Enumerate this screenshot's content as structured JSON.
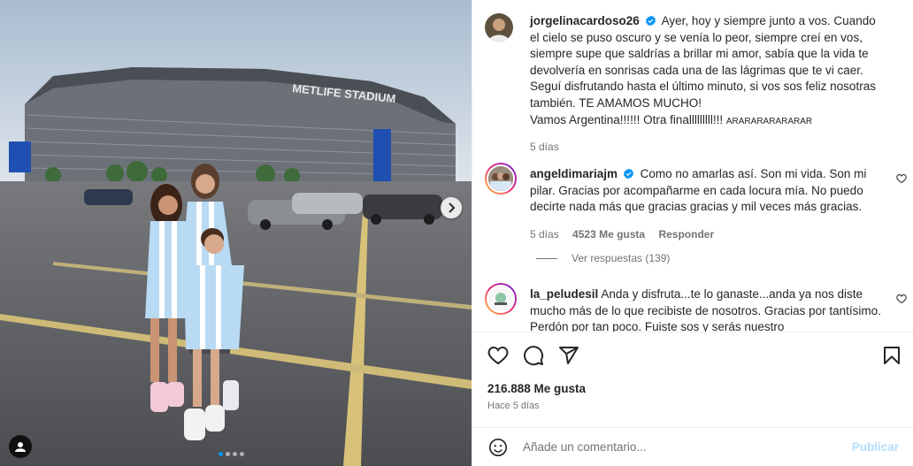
{
  "photo": {
    "stadium_sign": "METLIFE STADIUM",
    "carousel": {
      "count": 4,
      "active": 0
    }
  },
  "caption": {
    "username": "jorgelinacardoso26",
    "text": "Ayer, hoy y siempre junto a vos. Cuando el cielo se puso oscuro y se venía lo peor, siempre creí en vos, siempre supe que saldrías a brillar mi amor, sabía que la vida te devolvería en sonrisas cada una de las lágrimas que te vi caer. Seguí disfrutando hasta el último minuto, si vos sos feliz nosotras también. TE AMAMOS MUCHO!",
    "text2": "Vamos Argentina!!!!!! Otra finalllllllll!!!",
    "chant": "ARARARARARARAR",
    "time": "5 días"
  },
  "comments": [
    {
      "username": "angeldimariajm",
      "verified": true,
      "text": "Como no amarlas así. Son mi vida. Son mi pilar. Gracias por acompañarme en cada locura mía. No puedo decirte nada más que gracias gracias y mil veces más gracias.",
      "time": "5 días",
      "likes": "4523 Me gusta",
      "reply": "Responder",
      "view_replies": "Ver respuestas (139)"
    },
    {
      "username": "la_peludesil",
      "verified": false,
      "text": "Anda y disfruta...te lo ganaste...anda ya nos diste mucho más de lo que recibiste de nosotros. Gracias por tantísimo. Perdón por tan poco. Fuiste sos y serás nuestro"
    }
  ],
  "actions": {
    "likes": "216.888 Me gusta",
    "posted": "Hace 5 días",
    "icons": [
      "heart-icon",
      "comment-icon",
      "share-icon",
      "bookmark-icon"
    ]
  },
  "add_comment": {
    "placeholder": "Añade un comentario...",
    "publish": "Publicar"
  },
  "colors": {
    "verified": "#0095f6",
    "secondary": "#737373",
    "publish_disabled": "#b2dffc"
  }
}
